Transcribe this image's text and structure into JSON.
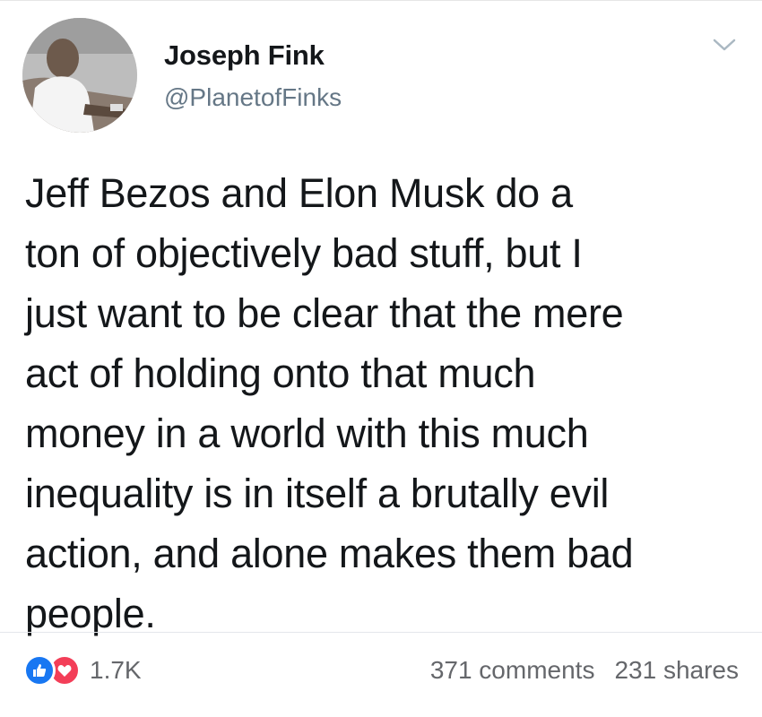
{
  "post": {
    "author": {
      "name": "Joseph Fink",
      "handle": "@PlanetofFinks"
    },
    "text": "Jeff Bezos and Elon Musk do a\nton of objectively bad stuff, but I\njust want to be clear that the mere\nact of holding onto that much\nmoney in a world with this much\ninequality is in itself a brutally evil\naction, and alone makes them bad\npeople."
  },
  "footer": {
    "reactions": {
      "icons": [
        "like-icon",
        "love-icon"
      ],
      "count": "1.7K"
    },
    "comments": "371 comments",
    "shares": "231 shares"
  },
  "colors": {
    "like": "#1877f2",
    "love": "#f33e58",
    "muted_text": "#65676b",
    "handle_text": "#657786"
  }
}
